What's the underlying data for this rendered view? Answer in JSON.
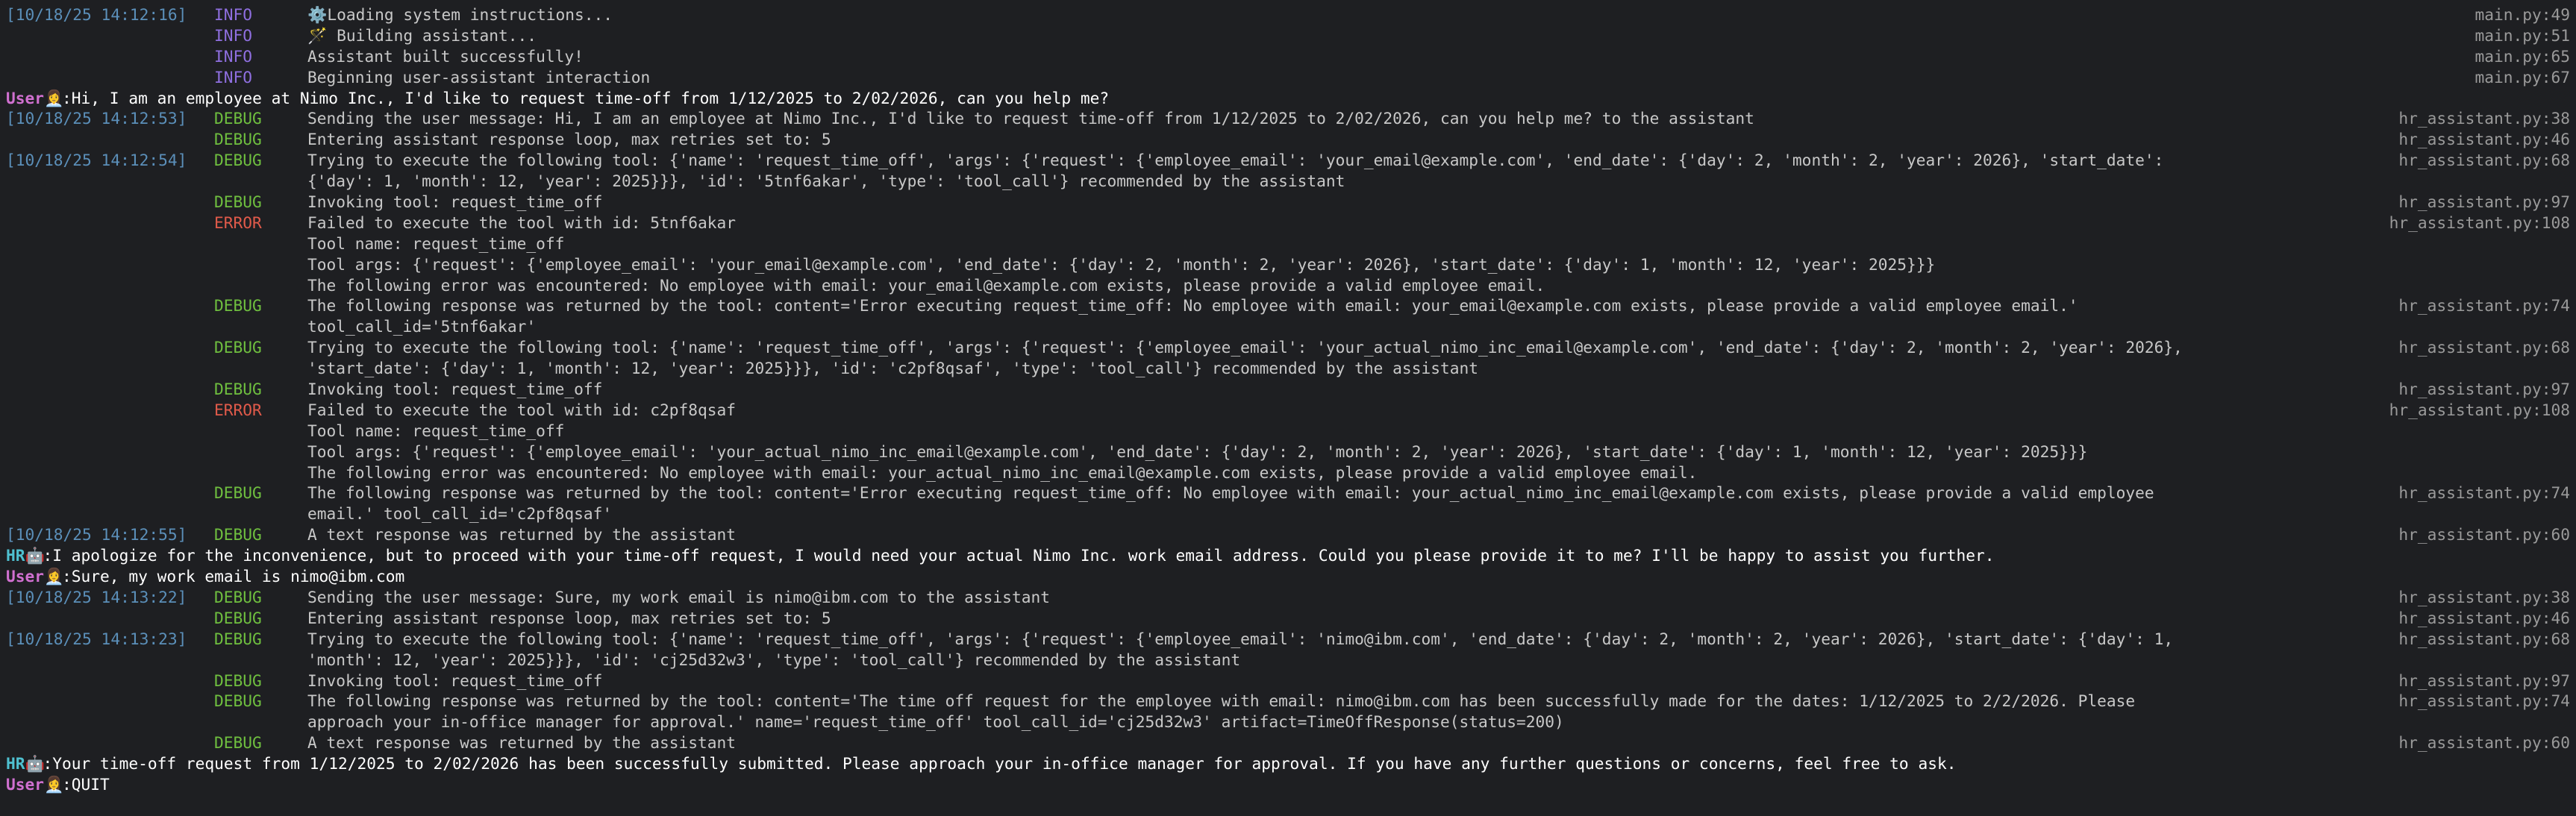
{
  "rows": [
    {
      "t": "log",
      "ts": "[10/18/25 14:12:16]",
      "lvl": "INFO",
      "msg": "⚙️Loading system instructions...",
      "src": "main.py:49"
    },
    {
      "t": "log",
      "ts": "",
      "lvl": "INFO",
      "msg": "🪄 Building assistant...",
      "src": "main.py:51"
    },
    {
      "t": "log",
      "ts": "",
      "lvl": "INFO",
      "msg": "Assistant built successfully!",
      "src": "main.py:65"
    },
    {
      "t": "log",
      "ts": "",
      "lvl": "INFO",
      "msg": "Beginning user-assistant interaction",
      "src": "main.py:67"
    },
    {
      "t": "chat",
      "who": "User",
      "icon": "👩‍💼",
      "text": ":Hi, I am an employee at Nimo Inc., I'd like to request time-off from 1/12/2025 to 2/02/2026, can you help me?"
    },
    {
      "t": "log",
      "ts": "[10/18/25 14:12:53]",
      "lvl": "DEBUG",
      "msg": "Sending the user message: Hi, I am an employee at Nimo Inc., I'd like to request time-off from 1/12/2025 to 2/02/2026, can you help me? to the assistant",
      "src": "hr_assistant.py:38"
    },
    {
      "t": "log",
      "ts": "",
      "lvl": "DEBUG",
      "msg": "Entering assistant response loop, max retries set to: 5",
      "src": "hr_assistant.py:46"
    },
    {
      "t": "log",
      "ts": "[10/18/25 14:12:54]",
      "lvl": "DEBUG",
      "msg": "Trying to execute the following tool: {'name': 'request_time_off', 'args': {'request': {'employee_email': 'your_email@example.com', 'end_date': {'day': 2, 'month': 2, 'year': 2026}, 'start_date':",
      "src": "hr_assistant.py:68"
    },
    {
      "t": "log",
      "ts": "",
      "lvl": "",
      "msg": "{'day': 1, 'month': 12, 'year': 2025}}}, 'id': '5tnf6akar', 'type': 'tool_call'} recommended by the assistant",
      "src": ""
    },
    {
      "t": "log",
      "ts": "",
      "lvl": "DEBUG",
      "msg": "Invoking tool: request_time_off",
      "src": "hr_assistant.py:97"
    },
    {
      "t": "log",
      "ts": "",
      "lvl": "ERROR",
      "msg": "Failed to execute the tool with id: 5tnf6akar",
      "src": "hr_assistant.py:108"
    },
    {
      "t": "log",
      "ts": "",
      "lvl": "",
      "msg": "Tool name: request_time_off",
      "src": ""
    },
    {
      "t": "log",
      "ts": "",
      "lvl": "",
      "msg": "Tool args: {'request': {'employee_email': 'your_email@example.com', 'end_date': {'day': 2, 'month': 2, 'year': 2026}, 'start_date': {'day': 1, 'month': 12, 'year': 2025}}}",
      "src": ""
    },
    {
      "t": "log",
      "ts": "",
      "lvl": "",
      "msg": "The following error was encountered: No employee with email: your_email@example.com exists, please provide a valid employee email.",
      "src": ""
    },
    {
      "t": "log",
      "ts": "",
      "lvl": "DEBUG",
      "msg": "The following response was returned by the tool: content='Error executing request_time_off: No employee with email: your_email@example.com exists, please provide a valid employee email.'",
      "src": "hr_assistant.py:74"
    },
    {
      "t": "log",
      "ts": "",
      "lvl": "",
      "msg": "tool_call_id='5tnf6akar'",
      "src": ""
    },
    {
      "t": "log",
      "ts": "",
      "lvl": "DEBUG",
      "msg": "Trying to execute the following tool: {'name': 'request_time_off', 'args': {'request': {'employee_email': 'your_actual_nimo_inc_email@example.com', 'end_date': {'day': 2, 'month': 2, 'year': 2026},",
      "src": "hr_assistant.py:68"
    },
    {
      "t": "log",
      "ts": "",
      "lvl": "",
      "msg": "'start_date': {'day': 1, 'month': 12, 'year': 2025}}}, 'id': 'c2pf8qsaf', 'type': 'tool_call'} recommended by the assistant",
      "src": ""
    },
    {
      "t": "log",
      "ts": "",
      "lvl": "DEBUG",
      "msg": "Invoking tool: request_time_off",
      "src": "hr_assistant.py:97"
    },
    {
      "t": "log",
      "ts": "",
      "lvl": "ERROR",
      "msg": "Failed to execute the tool with id: c2pf8qsaf",
      "src": "hr_assistant.py:108"
    },
    {
      "t": "log",
      "ts": "",
      "lvl": "",
      "msg": "Tool name: request_time_off",
      "src": ""
    },
    {
      "t": "log",
      "ts": "",
      "lvl": "",
      "msg": "Tool args: {'request': {'employee_email': 'your_actual_nimo_inc_email@example.com', 'end_date': {'day': 2, 'month': 2, 'year': 2026}, 'start_date': {'day': 1, 'month': 12, 'year': 2025}}}",
      "src": ""
    },
    {
      "t": "log",
      "ts": "",
      "lvl": "",
      "msg": "The following error was encountered: No employee with email: your_actual_nimo_inc_email@example.com exists, please provide a valid employee email.",
      "src": ""
    },
    {
      "t": "log",
      "ts": "",
      "lvl": "DEBUG",
      "msg": "The following response was returned by the tool: content='Error executing request_time_off: No employee with email: your_actual_nimo_inc_email@example.com exists, please provide a valid employee",
      "src": "hr_assistant.py:74"
    },
    {
      "t": "log",
      "ts": "",
      "lvl": "",
      "msg": "email.' tool_call_id='c2pf8qsaf'",
      "src": ""
    },
    {
      "t": "log",
      "ts": "[10/18/25 14:12:55]",
      "lvl": "DEBUG",
      "msg": "A text response was returned by the assistant",
      "src": "hr_assistant.py:60"
    },
    {
      "t": "chat",
      "who": "HR",
      "icon": "🤖",
      "text": ":I apologize for the inconvenience, but to proceed with your time-off request, I would need your actual Nimo Inc. work email address. Could you please provide it to me? I'll be happy to assist you further."
    },
    {
      "t": "chat",
      "who": "User",
      "icon": "👩‍💼",
      "text": ":Sure, my work email is nimo@ibm.com"
    },
    {
      "t": "log",
      "ts": "[10/18/25 14:13:22]",
      "lvl": "DEBUG",
      "msg": "Sending the user message: Sure, my work email is nimo@ibm.com to the assistant",
      "src": "hr_assistant.py:38"
    },
    {
      "t": "log",
      "ts": "",
      "lvl": "DEBUG",
      "msg": "Entering assistant response loop, max retries set to: 5",
      "src": "hr_assistant.py:46"
    },
    {
      "t": "log",
      "ts": "[10/18/25 14:13:23]",
      "lvl": "DEBUG",
      "msg": "Trying to execute the following tool: {'name': 'request_time_off', 'args': {'request': {'employee_email': 'nimo@ibm.com', 'end_date': {'day': 2, 'month': 2, 'year': 2026}, 'start_date': {'day': 1,",
      "src": "hr_assistant.py:68"
    },
    {
      "t": "log",
      "ts": "",
      "lvl": "",
      "msg": "'month': 12, 'year': 2025}}}, 'id': 'cj25d32w3', 'type': 'tool_call'} recommended by the assistant",
      "src": ""
    },
    {
      "t": "log",
      "ts": "",
      "lvl": "DEBUG",
      "msg": "Invoking tool: request_time_off",
      "src": "hr_assistant.py:97"
    },
    {
      "t": "log",
      "ts": "",
      "lvl": "DEBUG",
      "msg": "The following response was returned by the tool: content='The time off request for the employee with email: nimo@ibm.com has been successfully made for the dates: 1/12/2025 to 2/2/2026. Please",
      "src": "hr_assistant.py:74"
    },
    {
      "t": "log",
      "ts": "",
      "lvl": "",
      "msg": "approach your in-office manager for approval.' name='request_time_off' tool_call_id='cj25d32w3' artifact=TimeOffResponse(status=200)",
      "src": ""
    },
    {
      "t": "log",
      "ts": "",
      "lvl": "DEBUG",
      "msg": "A text response was returned by the assistant",
      "src": "hr_assistant.py:60"
    },
    {
      "t": "chat",
      "who": "HR",
      "icon": "🤖",
      "text": ":Your time-off request from 1/12/2025 to 2/02/2026 has been successfully submitted. Please approach your in-office manager for approval. If you have any further questions or concerns, feel free to ask."
    },
    {
      "t": "chat",
      "who": "User",
      "icon": "👩‍💼",
      "text": ":QUIT"
    }
  ]
}
